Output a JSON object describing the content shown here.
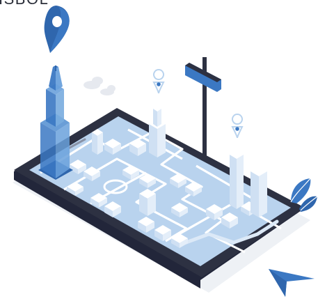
{
  "header_text": "ISBOL",
  "icons": {
    "large_pin": "map-pin-icon",
    "small_pin": "map-pin-icon",
    "signpost": "signpost-icon",
    "navigation_arrow": "navigation-arrow-icon",
    "clouds": "cloud-icon",
    "plant": "leaf-plant-icon",
    "skyscraper": "skyscraper-icon",
    "phone": "smartphone-icon"
  },
  "colors": {
    "primary_blue": "#3b78c3",
    "light_blue": "#b9d3ee",
    "pale_blue": "#dce9f7",
    "dark_frame": "#2d3142",
    "white": "#ffffff"
  }
}
